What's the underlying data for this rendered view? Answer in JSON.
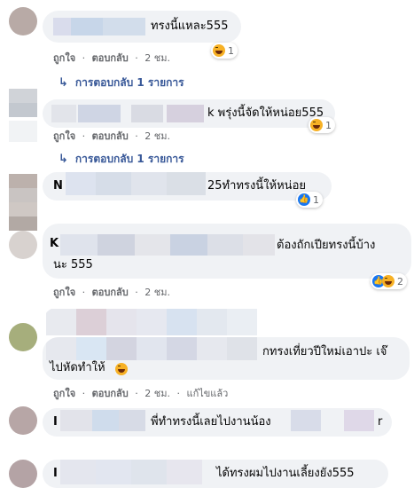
{
  "comments": [
    {
      "text": "ทรงนี้แหละ555",
      "time": "2 ชม.",
      "like": "ถูกใจ",
      "reply": "ตอบกลับ",
      "reaction_count": "1",
      "reaction": "haha-icon"
    },
    {
      "text": "k พรุ่งนี้จัดให้หน่อย555",
      "time": "2 ชม.",
      "like": "ถูกใจ",
      "reply": "ตอบกลับ",
      "reaction_count": "1",
      "reaction": "haha-icon"
    },
    {
      "author_initial": "N",
      "text": "25ทำทรงนี้ให้หน่อย",
      "reaction_count": "1",
      "reaction": "like-icon"
    },
    {
      "author_initial": "K",
      "text_line1": "ต้องถักเปียทรงนี้บ้าง",
      "text_line2": "นะ 555",
      "time": "2 ชม.",
      "like": "ถูกใจ",
      "reply": "ตอบกลับ",
      "reaction_count": "2"
    },
    {
      "text_line1": "กทรงเที่ยวปีใหม่เอาปะ เจ๊",
      "text_line2": "ไปหัดทำให้",
      "time": "2 ชม.",
      "like": "ถูกใจ",
      "reply": "ตอบกลับ",
      "edited": "แก้ไขแล้ว"
    },
    {
      "author_initial": "I",
      "text": "พี่ทำทรงนี้เลยไปงานน้อง",
      "text_tail": "r"
    },
    {
      "author_initial": "I",
      "text": "ได้ทรงผมไปงานเลี้ยงยัง555"
    }
  ],
  "replies": [
    {
      "label": "การตอบกลับ 1 รายการ"
    },
    {
      "label": "การตอบกลับ 1 รายการ"
    }
  ],
  "sep": "·",
  "colors": {
    "bubble": "#f0f2f5",
    "meta": "#65676b",
    "link": "#385898",
    "like": "#1877f2",
    "haha": "#f7b125"
  }
}
